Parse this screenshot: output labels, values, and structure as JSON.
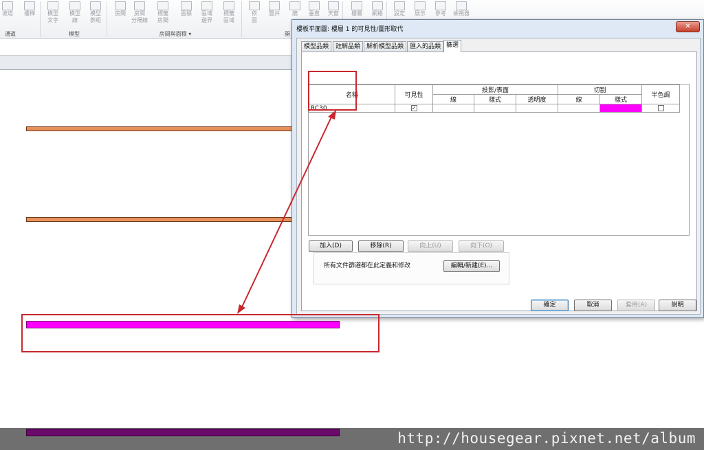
{
  "ribbon": {
    "tools": [
      {
        "label": "坡道"
      },
      {
        "label": "樓梯"
      },
      {
        "label": "模型\n文字"
      },
      {
        "label": "模型\n線"
      },
      {
        "label": "模型\n群組"
      },
      {
        "label": "房間"
      },
      {
        "label": "房間\n分隔線"
      },
      {
        "label": "標籤\n房間"
      },
      {
        "label": "面積"
      },
      {
        "label": "區域\n邊界"
      },
      {
        "label": "標籤\n區域"
      },
      {
        "label": "依\n面"
      },
      {
        "label": "豎井"
      },
      {
        "label": "牆"
      },
      {
        "label": "垂直"
      },
      {
        "label": "天窗"
      },
      {
        "label": "樓層"
      },
      {
        "label": "網格"
      },
      {
        "label": "設定"
      },
      {
        "label": "展示"
      },
      {
        "label": "參考"
      },
      {
        "label": "檢視器"
      }
    ],
    "panels": {
      "circulation": "通道",
      "model": "模型",
      "room_area": "房間與面積 ▾",
      "opening": "開"
    }
  },
  "dialog": {
    "title": "樓板平面圖: 樓層 1 的可見性/圖形取代",
    "close": "✕",
    "tabs": [
      "模型品類",
      "註解品類",
      "解析模型品類",
      "匯入的品類",
      "篩選"
    ],
    "active_tab": 4,
    "table": {
      "headers": {
        "name": "名稱",
        "visibility": "可見性",
        "projection": "投影/表面",
        "lines": "線",
        "patterns": "樣式",
        "transparency": "透明度",
        "cut": "切割",
        "cut_lines": "線",
        "cut_patterns": "樣式",
        "halftone": "半色調"
      },
      "rows": [
        {
          "name": "RC30",
          "visible": true,
          "halftone": false,
          "cut_pattern_color": "#ff00ff"
        }
      ]
    },
    "buttons": {
      "add": "加入(D)",
      "remove": "移除(R)",
      "up": "向上(U)",
      "down": "向下(O)",
      "edit_new": "編輯/新建(E)...",
      "ok": "確定",
      "cancel": "取消",
      "apply": "套用(A)",
      "help": "說明"
    },
    "info_text": "所有文件篩選都在此定義和修改"
  },
  "colors": {
    "wall_orange": "#e8915a",
    "wall_magenta": "#ff00ff",
    "wall_purple": "#6b0a6b",
    "annotation_red": "#c8282d"
  },
  "watermark": "http://housegear.pixnet.net/album"
}
